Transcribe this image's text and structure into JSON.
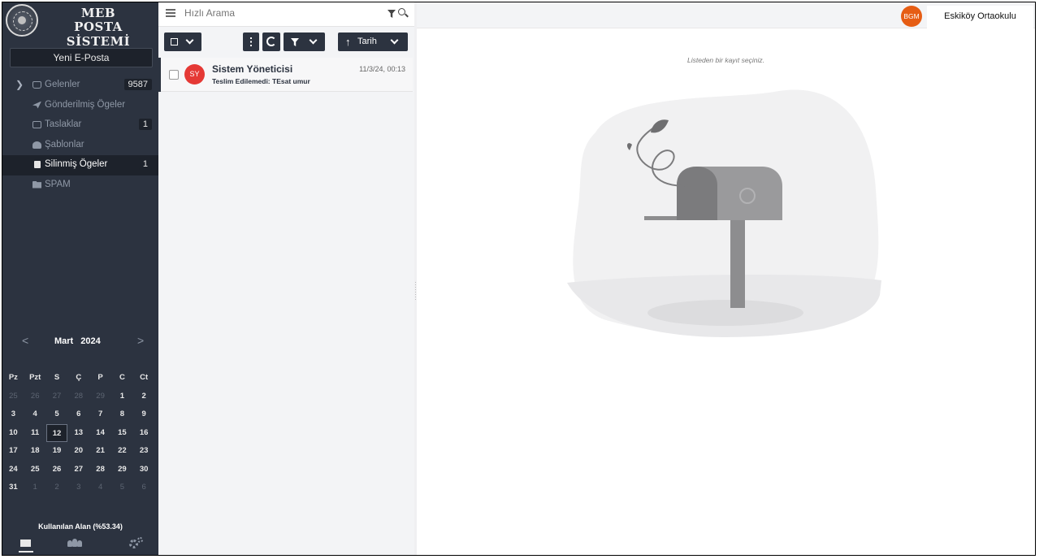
{
  "brand": {
    "line1": "MEB",
    "line2": "POSTA SİSTEMİ"
  },
  "sidebar": {
    "new_mail": "Yeni E-Posta",
    "folders": [
      {
        "label": "Gelenler",
        "count": "9587",
        "icon": "inbox-icon"
      },
      {
        "label": "Gönderilmiş Ögeler",
        "count": "",
        "icon": "send-icon"
      },
      {
        "label": "Taslaklar",
        "count": "1",
        "icon": "drafts-icon"
      },
      {
        "label": "Şablonlar",
        "count": "",
        "icon": "templates-icon"
      },
      {
        "label": "Silinmiş Ögeler",
        "count": "1",
        "icon": "trash-icon"
      },
      {
        "label": "SPAM",
        "count": "",
        "icon": "folder-icon"
      }
    ],
    "calendar": {
      "month": "Mart",
      "year": "2024",
      "weekdays": [
        "Pz",
        "Pzt",
        "S",
        "Ç",
        "P",
        "C",
        "Ct"
      ],
      "weeks": [
        [
          "25",
          "26",
          "27",
          "28",
          "29",
          "1",
          "2"
        ],
        [
          "3",
          "4",
          "5",
          "6",
          "7",
          "8",
          "9"
        ],
        [
          "10",
          "11",
          "12",
          "13",
          "14",
          "15",
          "16"
        ],
        [
          "17",
          "18",
          "19",
          "20",
          "21",
          "22",
          "23"
        ],
        [
          "24",
          "25",
          "26",
          "27",
          "28",
          "29",
          "30"
        ],
        [
          "31",
          "1",
          "2",
          "3",
          "4",
          "5",
          "6"
        ]
      ],
      "today": "12"
    },
    "usage": "Kullanılan Alan (%53.34)"
  },
  "search": {
    "placeholder": "Hızlı Arama"
  },
  "toolbar": {
    "sort_label": "Tarih",
    "sort_arrow": "↑"
  },
  "messages": [
    {
      "avatar": "SY",
      "from": "Sistem Yöneticisi",
      "subject": "Teslim Edilemedi: TEsat umur",
      "date": "11/3/24, 00:13"
    }
  ],
  "reading_pane": {
    "empty_hint": "Listeden bir kayıt seçiniz."
  },
  "header": {
    "user_initials": "BGM",
    "school": "Eskiköy Ortaokulu"
  },
  "colors": {
    "sidebar": "#2c3340",
    "avatar_sy": "#e53935",
    "avatar_bgm": "#e65d14"
  }
}
